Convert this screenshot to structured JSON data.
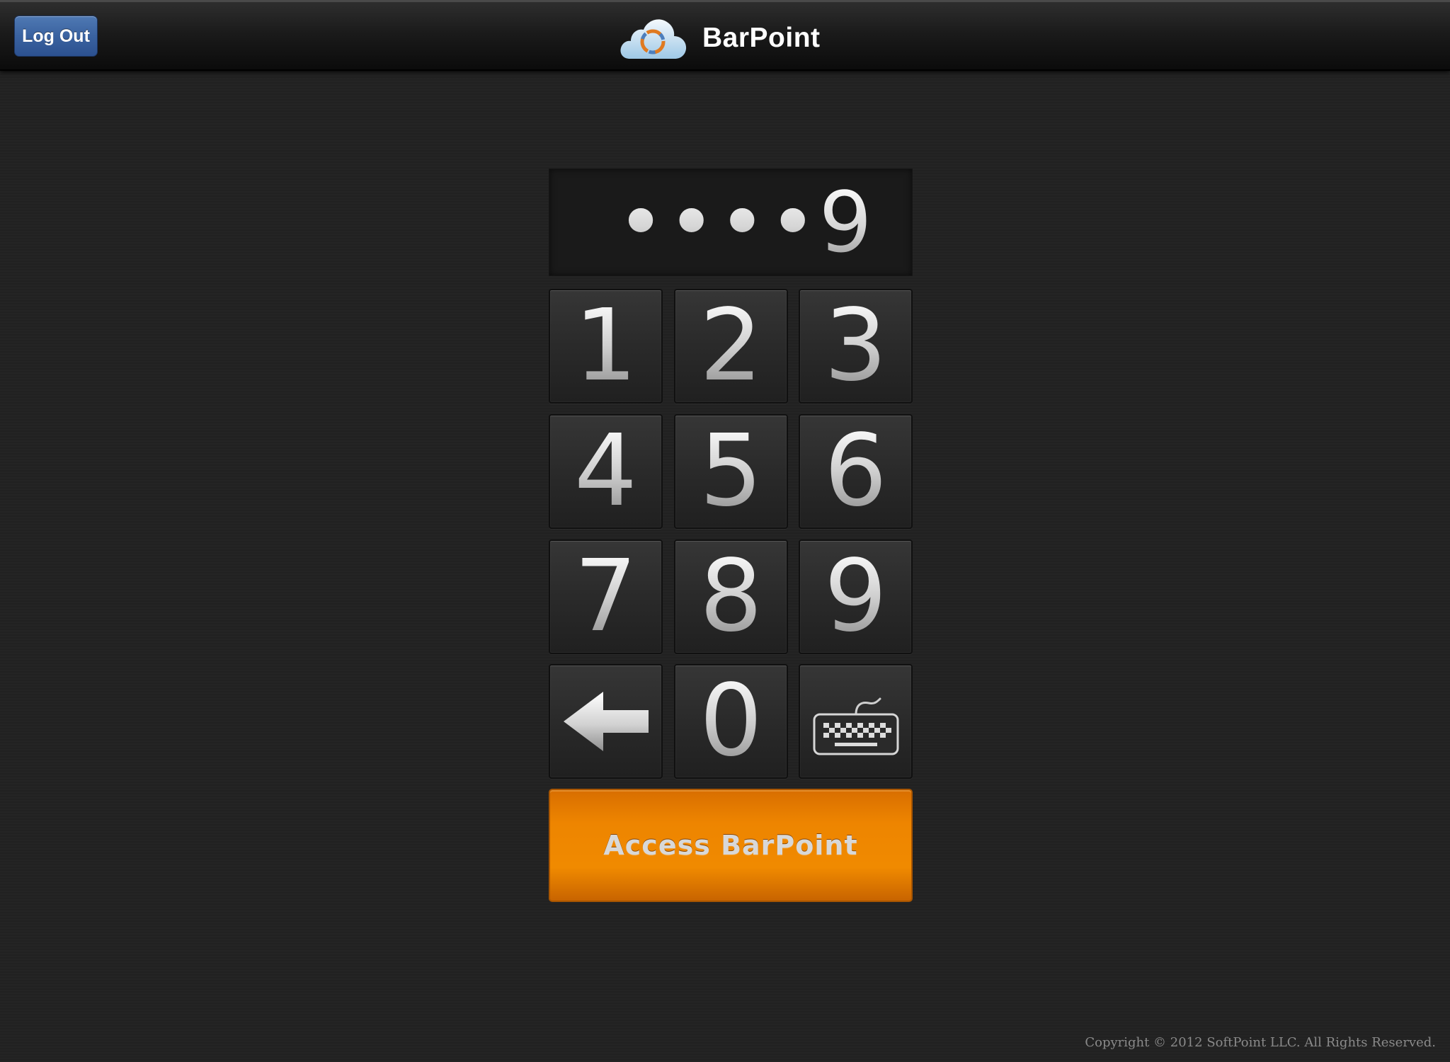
{
  "header": {
    "logout_label": "Log Out",
    "app_name": "BarPoint",
    "logo_icon": "cloud-logo-icon"
  },
  "pin_display": {
    "value": "••••9"
  },
  "keypad": {
    "keys": [
      "1",
      "2",
      "3",
      "4",
      "5",
      "6",
      "7",
      "8",
      "9",
      "0"
    ],
    "backspace_icon": "left-arrow-icon",
    "keyboard_icon": "keyboard-icon"
  },
  "access_button": {
    "label": "Access BarPoint"
  },
  "footer": {
    "copyright": "Copyright © 2012 SoftPoint LLC. All Rights Reserved."
  },
  "colors": {
    "background": "#212121",
    "logout_blue": "#3a62a0",
    "access_orange": "#ee8500"
  }
}
